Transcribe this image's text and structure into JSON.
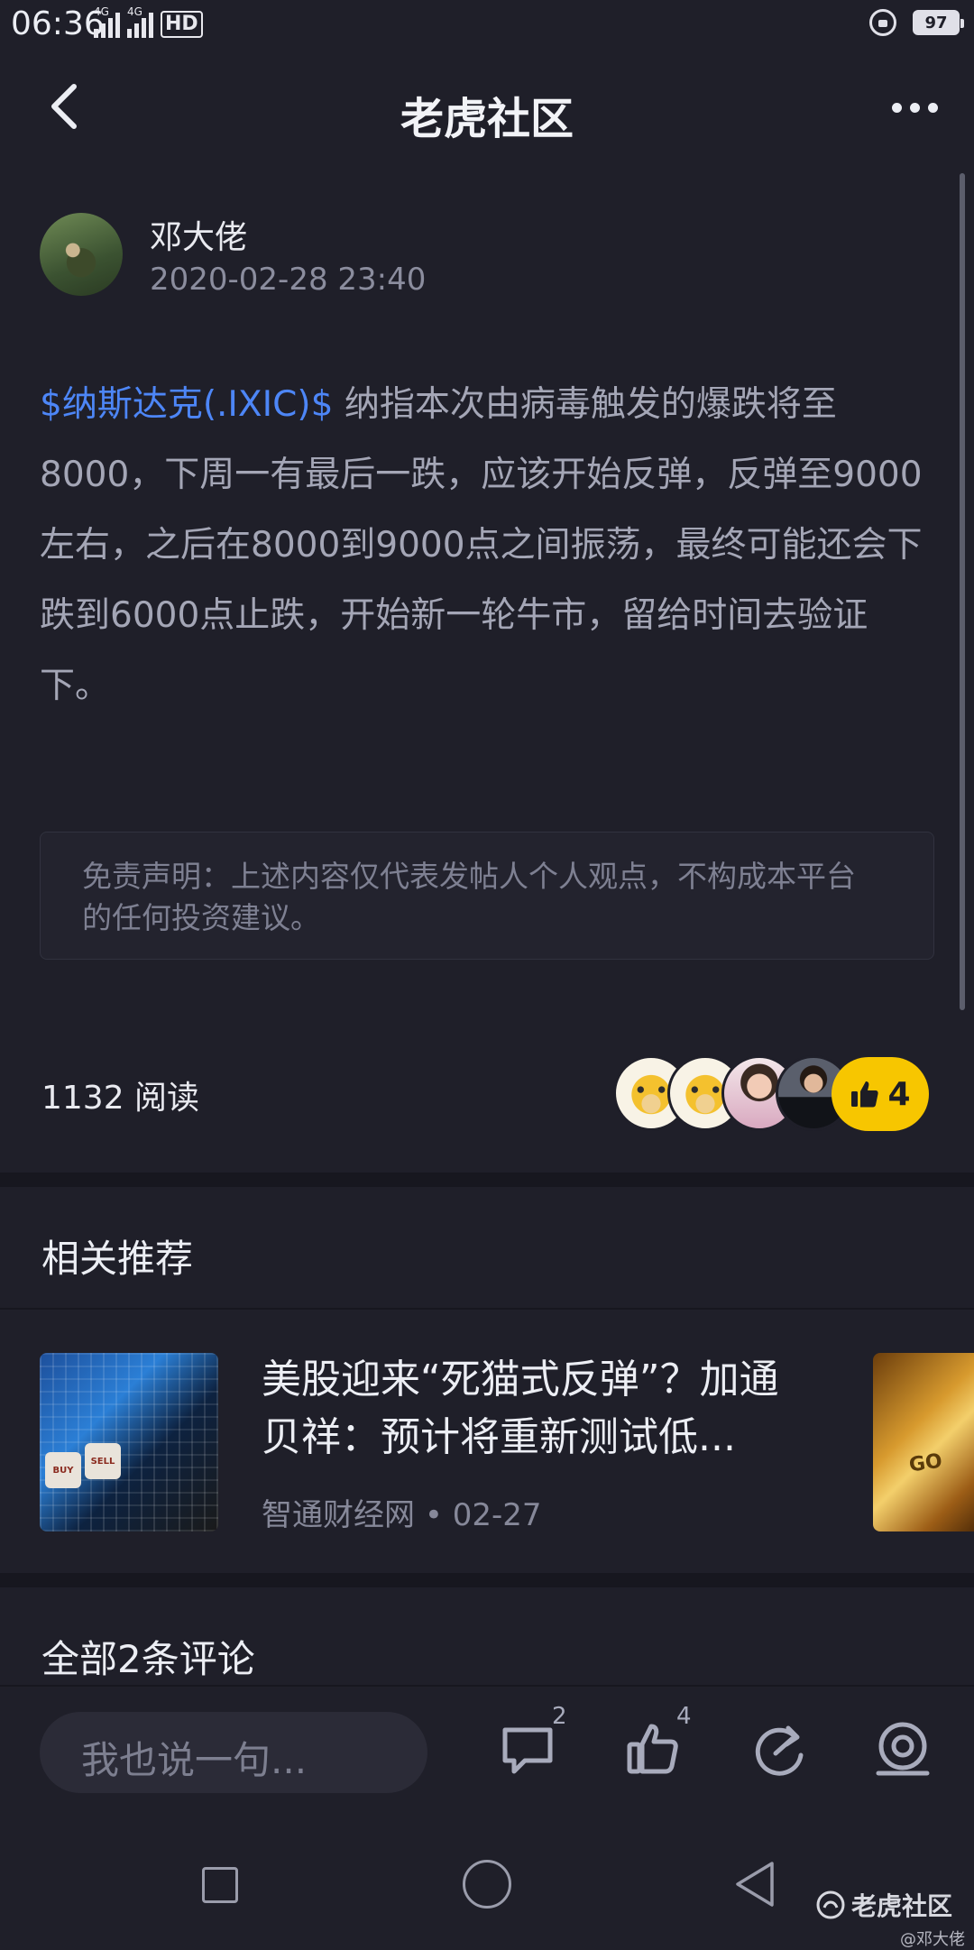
{
  "status_bar": {
    "time": "06:36",
    "network_1": "4G",
    "network_2": "4G",
    "hd_label": "HD",
    "battery": "97"
  },
  "header": {
    "title": "老虎社区"
  },
  "post": {
    "author": "邓大佬",
    "date": "2020-02-28 23:40",
    "stock_tag": "$纳斯达克(.IXIC)$",
    "body": " 纳指本次由病毒触发的爆跌将至8000，下周一有最后一跌，应该开始反弹，反弹至9000左右，之后在8000到9000点之间振荡，最终可能还会下跌到6000点止跌，开始新一轮牛市，留给时间去验证下。",
    "disclaimer": "免责声明：上述内容仅代表发帖人个人观点，不构成本平台的任何投资建议。",
    "read_count": "1132 阅读",
    "like_count": "4"
  },
  "recommend": {
    "section_title": "相关推荐",
    "items": [
      {
        "title": "美股迎来“死猫式反弹”？加通贝祥：预计将重新测试低...",
        "source": "智通财经网",
        "date": "02-27",
        "dice_labels": [
          "BUY",
          "SELL"
        ]
      }
    ],
    "partial_thumb_text": "GO"
  },
  "comments": {
    "title": "全部2条评论"
  },
  "action_bar": {
    "input_placeholder": "我也说一句...",
    "comment_count": "2",
    "like_count": "4"
  },
  "watermark": {
    "brand": "老虎社区",
    "user": "@邓大佬"
  },
  "colors": {
    "background": "#1f1f29",
    "accent_link": "#4d86f7",
    "like_yellow": "#f7c600"
  }
}
